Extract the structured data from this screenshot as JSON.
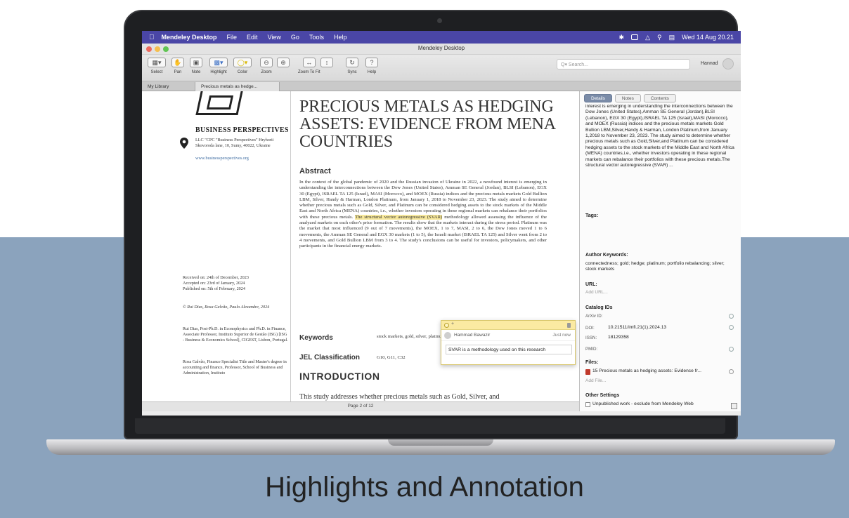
{
  "menubar": {
    "app": "Mendeley Desktop",
    "items": [
      "File",
      "Edit",
      "View",
      "Go",
      "Tools",
      "Help"
    ],
    "datetime": "Wed 14 Aug 20.21"
  },
  "window": {
    "title": "Mendeley Desktop"
  },
  "toolbar": {
    "buttons": [
      {
        "label": "Select",
        "icon": "select-icon"
      },
      {
        "label": "Pan",
        "icon": "hand-icon"
      },
      {
        "label": "Note",
        "icon": "note-icon"
      },
      {
        "label": "Highlight",
        "icon": "highlight-icon"
      },
      {
        "label": "Color",
        "icon": "color-icon"
      },
      {
        "label": "Zoom",
        "icon": "zoom-out-icon"
      },
      {
        "label": "",
        "icon": "zoom-in-icon"
      },
      {
        "label": "Zoom To Fit",
        "icon": "fit-width-icon"
      },
      {
        "label": "",
        "icon": "fit-height-icon"
      },
      {
        "label": "Sync",
        "icon": "sync-icon"
      },
      {
        "label": "Help",
        "icon": "help-icon"
      }
    ],
    "search_placeholder": "Q▾ Search...",
    "user": "Hannad"
  },
  "tabs": [
    "My Library",
    "Precious metals as hedge..."
  ],
  "pdf": {
    "publisher": "BUSINESS PERSPECTIVES",
    "address": "LLC \"CPC \"Business Perspectives\" Hryhorii Skovoroda lane, 10, Sumy, 40022, Ukraine",
    "url": "www.businessperspectives.org",
    "received": "Received on: 24th of December, 2023",
    "accepted": "Accepted on: 23rd of January, 2024",
    "published": "Published on: 5th of February, 2024",
    "copyright": "© Rui Dias, Rosa Galvão, Paulo Alexandre, 2024",
    "bio1": "Rui Dias, Post-Ph.D. in Econophysics and Ph.D. in Finance, Associate Professor, Instituto Superior de Gestão (ISG) [ISG - Business & Economics School], CIGEST, Lisbon, Portugal.",
    "bio2": "Rosa Galvão, Finance Specialist Title and Master's degree in accounting and finance, Professor, School of Business and Administration, Instituto",
    "title": "PRECIOUS METALS AS HEDGING ASSETS: EVIDENCE FROM MENA COUNTRIES",
    "abstract_heading": "Abstract",
    "abstract_part1": "In the context of the global pandemic of 2020 and the Russian invasion of Ukraine in 2022, a newfound interest is emerging in understanding the interconnections between the Dow Jones (United States), Amman SE General (Jordan), BLSI (Lebanon), EGX 30 (Egypt), ISRAEL TA 125 (Israel), MASI (Morocco), and MOEX (Russia) indices and the precious metals markets Gold Bullion LBM, Silver, Handy & Harman, London Platinum, from January 1, 2018 to November 23, 2023. The study aimed to determine whether precious metals such as Gold, Silver, and Platinum can be considered hedging assets to the stock markets of the Middle East and North Africa (MENA) countries, i.e., whether investors operating in these regional markets can rebalance their portfolios with these precious metals.",
    "abstract_highlight": "The structural vector autoregressive (SVAR)",
    "abstract_part2": "methodology allowed assessing the influence of the analyzed markets on each other's price formation. The results show that the markets interact during the stress period. Platinum was the market that most influenced (9 out of 7 movements), the MOEX, 1 to 7, MASI, 2 to 6, the Dow Jones moved 1 to 6 movements, the Amman SE General and EGX 30 markets (1 to 5), the Israeli market (ISRAEL TA 125) and Silver went from 2 to 4 movements, and Gold Bullion LBM from 3 to 4. The study's conclusions can be useful for investors, policymakers, and other participants in the financial energy markets.",
    "keywords_heading": "Keywords",
    "keywords": "stock markets, gold, silver, platinum, connectedness, hedge, portfolio rebalancing",
    "jel_heading": "JEL Classification",
    "jel": "G10, G11, C32",
    "intro_heading": "INTRODUCTION",
    "intro_text": "This study addresses whether precious metals such as Gold, Silver, and"
  },
  "note": {
    "plus": "+",
    "user": "Hammad Bawazir",
    "time": "Just now",
    "text": "SVAR is a methodology used on this research"
  },
  "statusbar": {
    "page": "Page 2 of 12"
  },
  "details": {
    "tabs": [
      "Details",
      "Notes",
      "Contents"
    ],
    "abstract": "interest is emerging in understanding the interconnections between the Dow Jones (United States),Amman SE General (Jordan),BLSI (Lebanon), EGX 30 (Egypt),ISRAEL TA 125 (Israel),MASI (Morocco), and MOEX (Russia) indices and the precious metals markets Gold Bullion LBM,Silver,Handy & Harman, London Platinum,from January 1,2018 to November 23, 2023. The study aimed to determine whether precious metals such as Gold,Silver,and Platinum can be considered hedging assets to the stock markets of the Middle East and North Africa (MENA) countries,i.e., whether investors operating in these regional markets can rebalance their portfolios with these precious metals.The structural vector autoregressive (SVAR) ...",
    "tags_label": "Tags:",
    "author_kw_label": "Author Keywords:",
    "author_kw": "connectedness; gold; hedge; platinum; portfolio rebalancing; silver; stock markets",
    "url_label": "URL:",
    "url_add": "Add URL...",
    "catalog_label": "Catalog IDs",
    "arxiv_key": "ArXiv ID:",
    "doi_key": "DOI:",
    "doi_val": "10.21511/imfi.21(1).2024.13",
    "issn_key": "ISSN:",
    "issn_val": "18129358",
    "pmid_key": "PMID:",
    "files_label": "Files:",
    "file_name": "15 Precious metals as hedging assets: Evidence fr...",
    "add_file": "Add File...",
    "other_label": "Other Settings",
    "unpublished": "Unpublished work - exclude from Mendeley Web"
  },
  "caption": "Highlights and Annotation",
  "colors": {
    "menubar": "#4a46a6",
    "background": "#8ba3bd",
    "highlight": "#f6e79a"
  }
}
